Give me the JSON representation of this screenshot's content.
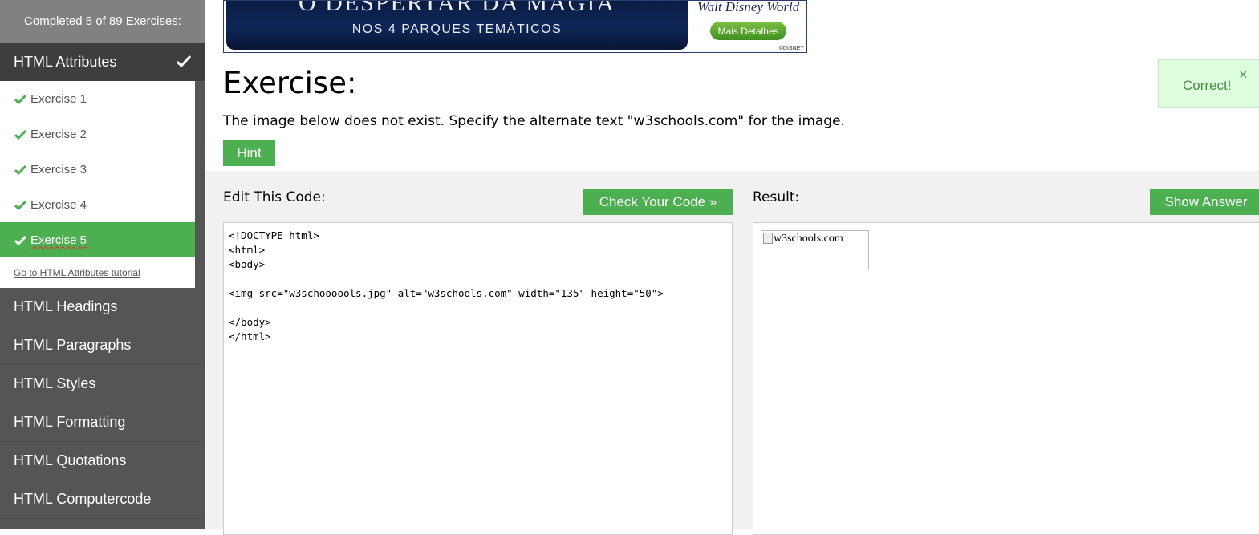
{
  "sidebar": {
    "progress": "Completed 5 of 89 Exercises:",
    "active_section": "HTML Attributes",
    "exercises": [
      "Exercise 1",
      "Exercise 2",
      "Exercise 3",
      "Exercise 4",
      "Exercise 5"
    ],
    "current_exercise": 4,
    "tutorial_link": "Go to HTML Attributes tutorial",
    "categories": [
      "HTML Headings",
      "HTML Paragraphs",
      "HTML Styles",
      "HTML Formatting",
      "HTML Quotations",
      "HTML Computercode"
    ]
  },
  "ad": {
    "title": "O DESPERTAR DA MAGIA",
    "subtitle": "NOS 4 PARQUES TEMÁTICOS",
    "brand": "Walt Disney World",
    "button": "Mais Detalhes",
    "copyright": "©DISNEY"
  },
  "exercise": {
    "title": "Exercise:",
    "description": "The image below does not exist. Specify the alternate text \"w3schools.com\" for the image.",
    "hint_label": "Hint"
  },
  "notification": {
    "text": "Correct!",
    "close": "×"
  },
  "editor": {
    "label": "Edit This Code:",
    "check_label": "Check Your Code »",
    "lines": [
      "<!DOCTYPE html>",
      "<html>",
      "<body>",
      "",
      "<img src=\"w3schoooools.jpg\" alt=\"w3schools.com\" width=\"135\" height=\"50\">",
      "",
      "</body>",
      "</html>"
    ]
  },
  "result": {
    "label": "Result:",
    "show_answer_label": "Show Answer",
    "alt_text": "w3schools.com"
  },
  "colors": {
    "accent_green": "#4CAF50",
    "sidebar_dark": "#555555",
    "sidebar_active": "#3e3e3e",
    "work_area": "#f1f1f1"
  }
}
